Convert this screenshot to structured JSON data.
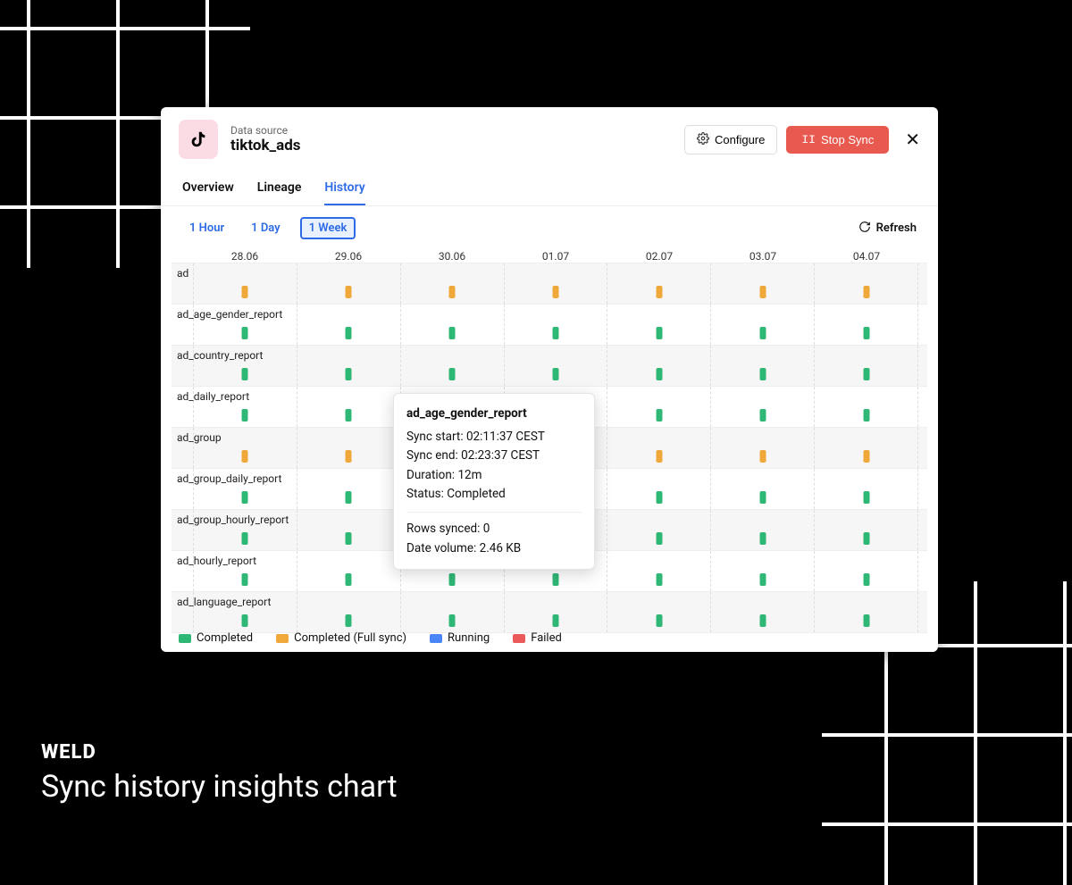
{
  "brand": "WELD",
  "caption": "Sync history insights chart",
  "header": {
    "label": "Data source",
    "title": "tiktok_ads",
    "configure": "Configure",
    "stop": "Stop Sync"
  },
  "tabs": {
    "overview": "Overview",
    "lineage": "Lineage",
    "history": "History",
    "active": "History"
  },
  "ranges": {
    "r1": "1 Hour",
    "r2": "1 Day",
    "r3": "1 Week",
    "selected": "1 Week"
  },
  "refresh": "Refresh",
  "chart_data": {
    "type": "bar",
    "categories": [
      "28.06",
      "29.06",
      "30.06",
      "01.07",
      "02.07",
      "03.07",
      "04.07"
    ],
    "series": [
      {
        "name": "ad",
        "colors": [
          "orange",
          "orange",
          "orange",
          "orange",
          "orange",
          "orange",
          "orange"
        ]
      },
      {
        "name": "ad_age_gender_report",
        "colors": [
          "green",
          "green",
          "green",
          "green",
          "green",
          "green",
          "green"
        ]
      },
      {
        "name": "ad_country_report",
        "colors": [
          "green",
          "green",
          "green",
          "green",
          "green",
          "green",
          "green"
        ]
      },
      {
        "name": "ad_daily_report",
        "colors": [
          "green",
          "green",
          "green",
          "green",
          "green",
          "green",
          "green"
        ]
      },
      {
        "name": "ad_group",
        "colors": [
          "orange",
          "orange",
          "orange",
          "orange",
          "orange",
          "orange",
          "orange"
        ]
      },
      {
        "name": "ad_group_daily_report",
        "colors": [
          "green",
          "green",
          "green",
          "green",
          "green",
          "green",
          "green"
        ]
      },
      {
        "name": "ad_group_hourly_report",
        "colors": [
          "green",
          "green",
          "green",
          "green",
          "green",
          "green",
          "green"
        ]
      },
      {
        "name": "ad_hourly_report",
        "colors": [
          "green",
          "green",
          "green",
          "green",
          "green",
          "green",
          "green"
        ]
      },
      {
        "name": "ad_language_report",
        "colors": [
          "green",
          "green",
          "green",
          "green",
          "green",
          "green",
          "green"
        ]
      }
    ],
    "legend": {
      "completed": "Completed",
      "full": "Completed (Full sync)",
      "running": "Running",
      "failed": "Failed"
    }
  },
  "tooltip": {
    "title": "ad_age_gender_report",
    "start_lbl": "Sync start:",
    "start": "02:11:37 CEST",
    "end_lbl": "Sync end:",
    "end": "02:23:37 CEST",
    "dur_lbl": "Duration:",
    "dur": "12m",
    "status_lbl": "Status:",
    "status": "Completed",
    "rows_lbl": "Rows synced:",
    "rows": "0",
    "vol_lbl": "Date volume:",
    "vol": "2.46 KB"
  }
}
